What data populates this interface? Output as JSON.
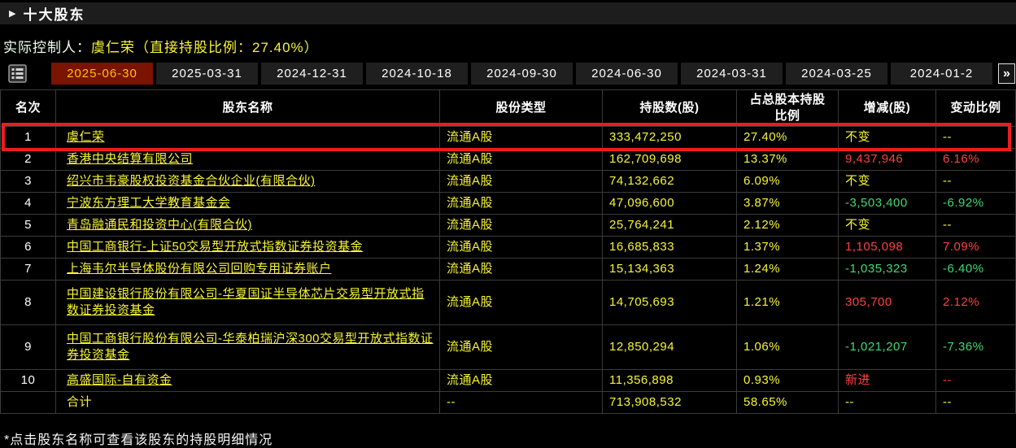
{
  "colors": {
    "yellow": "#f7f535",
    "red": "#ff4040",
    "green": "#3fd973",
    "grid": "#3a3a3a",
    "highlight_border": "#ec1c1c",
    "titlebar_bg": "#1d1d1d",
    "tab_bg": "#1f1f1f",
    "tab_active_bg": "#7a1300",
    "tab_active_fg": "#ffc100"
  },
  "header": {
    "caret_icon": "▶",
    "title": "十大股东"
  },
  "controller": {
    "label": "实际控制人：",
    "value": "虞仁荣（直接持股比例：27.40%）"
  },
  "toolbar": {
    "list_icon": "list-icon",
    "more_label": "»",
    "tabs": [
      {
        "label": "2025-06-30",
        "active": true
      },
      {
        "label": "2025-03-31",
        "active": false
      },
      {
        "label": "2024-12-31",
        "active": false
      },
      {
        "label": "2024-10-18",
        "active": false
      },
      {
        "label": "2024-09-30",
        "active": false
      },
      {
        "label": "2024-06-30",
        "active": false
      },
      {
        "label": "2024-03-31",
        "active": false
      },
      {
        "label": "2024-03-25",
        "active": false
      },
      {
        "label": "2024-01-2",
        "active": false
      }
    ]
  },
  "table": {
    "columns": [
      "名次",
      "股东名称",
      "股份类型",
      "持股数(股)",
      "占总股本持股比例",
      "增减(股)",
      "变动比例"
    ],
    "highlight_rank": "1",
    "rows": [
      {
        "rank": "1",
        "name": "虞仁荣",
        "link": true,
        "type": "流通A股",
        "shares": "333,472,250",
        "pct": "27.40%",
        "change": "不变",
        "change_color": "yellow",
        "change_pct": "--",
        "change_pct_color": "yellow",
        "tall": false
      },
      {
        "rank": "2",
        "name": "香港中央结算有限公司",
        "link": true,
        "type": "流通A股",
        "shares": "162,709,698",
        "pct": "13.37%",
        "change": "9,437,946",
        "change_color": "red",
        "change_pct": "6.16%",
        "change_pct_color": "red",
        "tall": false
      },
      {
        "rank": "3",
        "name": "绍兴市韦豪股权投资基金合伙企业(有限合伙)",
        "link": true,
        "type": "流通A股",
        "shares": "74,132,662",
        "pct": "6.09%",
        "change": "不变",
        "change_color": "yellow",
        "change_pct": "--",
        "change_pct_color": "yellow",
        "tall": false
      },
      {
        "rank": "4",
        "name": "宁波东方理工大学教育基金会",
        "link": true,
        "type": "流通A股",
        "shares": "47,096,600",
        "pct": "3.87%",
        "change": "-3,503,400",
        "change_color": "green",
        "change_pct": "-6.92%",
        "change_pct_color": "green",
        "tall": false
      },
      {
        "rank": "5",
        "name": "青岛融通民和投资中心(有限合伙)",
        "link": true,
        "type": "流通A股",
        "shares": "25,764,241",
        "pct": "2.12%",
        "change": "不变",
        "change_color": "yellow",
        "change_pct": "--",
        "change_pct_color": "yellow",
        "tall": false
      },
      {
        "rank": "6",
        "name": "中国工商银行-上证50交易型开放式指数证券投资基金",
        "link": true,
        "type": "流通A股",
        "shares": "16,685,833",
        "pct": "1.37%",
        "change": "1,105,098",
        "change_color": "red",
        "change_pct": "7.09%",
        "change_pct_color": "red",
        "tall": false
      },
      {
        "rank": "7",
        "name": "上海韦尔半导体股份有限公司回购专用证券账户",
        "link": true,
        "type": "流通A股",
        "shares": "15,134,363",
        "pct": "1.24%",
        "change": "-1,035,323",
        "change_color": "green",
        "change_pct": "-6.40%",
        "change_pct_color": "green",
        "tall": false
      },
      {
        "rank": "8",
        "name": "中国建设银行股份有限公司-华夏国证半导体芯片交易型开放式指数证券投资基金",
        "link": true,
        "type": "流通A股",
        "shares": "14,705,693",
        "pct": "1.21%",
        "change": "305,700",
        "change_color": "red",
        "change_pct": "2.12%",
        "change_pct_color": "red",
        "tall": true
      },
      {
        "rank": "9",
        "name": "中国工商银行股份有限公司-华泰柏瑞沪深300交易型开放式指数证券投资基金",
        "link": true,
        "type": "流通A股",
        "shares": "12,850,294",
        "pct": "1.06%",
        "change": "-1,021,207",
        "change_color": "green",
        "change_pct": "-7.36%",
        "change_pct_color": "green",
        "tall": true
      },
      {
        "rank": "10",
        "name": "高盛国际-自有资金",
        "link": true,
        "type": "流通A股",
        "shares": "11,356,898",
        "pct": "0.93%",
        "change": "新进",
        "change_color": "red",
        "change_pct": "--",
        "change_pct_color": "red",
        "tall": false
      },
      {
        "rank": "",
        "name": "合计",
        "link": false,
        "type": "--",
        "shares": "713,908,532",
        "pct": "58.65%",
        "change": "--",
        "change_color": "yellow",
        "change_pct": "--",
        "change_pct_color": "yellow",
        "tall": false
      }
    ]
  },
  "footer": {
    "note": "*点击股东名称可查看该股东的持股明细情况"
  }
}
